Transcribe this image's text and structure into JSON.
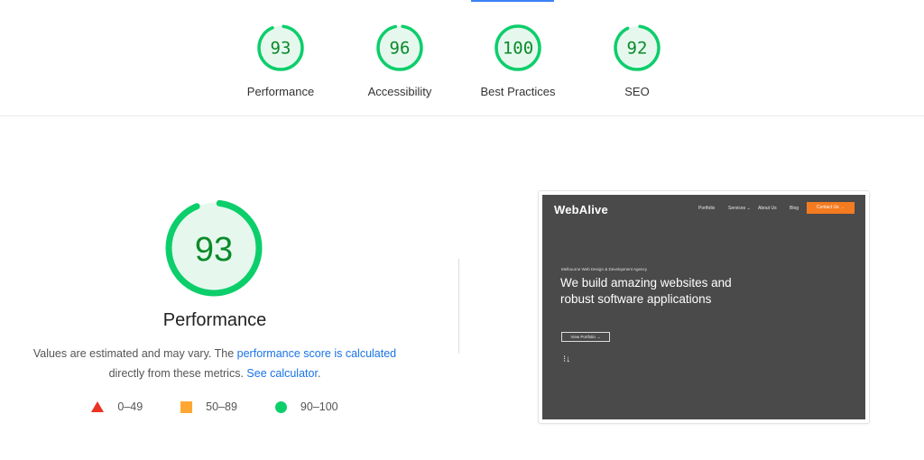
{
  "summary": {
    "gauges": [
      {
        "label": "Performance",
        "score": "93",
        "fraction": 0.93
      },
      {
        "label": "Accessibility",
        "score": "96",
        "fraction": 0.96
      },
      {
        "label": "Best Practices",
        "score": "100",
        "fraction": 1.0
      },
      {
        "label": "SEO",
        "score": "92",
        "fraction": 0.92
      }
    ]
  },
  "performance": {
    "score": "93",
    "fraction": 0.93,
    "title": "Performance",
    "desc_prefix": "Values are estimated and may vary. The ",
    "desc_link1": "performance score is calculated",
    "desc_middle": " directly from these metrics. ",
    "desc_link2": "See calculator",
    "desc_suffix": "."
  },
  "legend": [
    {
      "shape": "triangle-icon",
      "range": "0–49",
      "color": "#eb3323"
    },
    {
      "shape": "square-icon",
      "range": "50–89",
      "color": "#ffa733"
    },
    {
      "shape": "circle-icon",
      "range": "90–100",
      "color": "#0cce6b"
    }
  ],
  "screenshot": {
    "logo": "WebAlive",
    "nav": [
      "Portfolio",
      "Services ⌄",
      "About Us",
      "Blog"
    ],
    "contact": "Contact Us →",
    "eyebrow": "Melbourne Web Design & Development Agency",
    "hero": "We build amazing websites and robust software applications",
    "portfolio_button": "View Portfolio →",
    "scroll_icon": "⁝↓"
  },
  "colors": {
    "pass": "#0cce6b",
    "pass_fill": "#e6f8ee",
    "pass_text": "#0a8a2a",
    "link": "#1a73e8"
  }
}
